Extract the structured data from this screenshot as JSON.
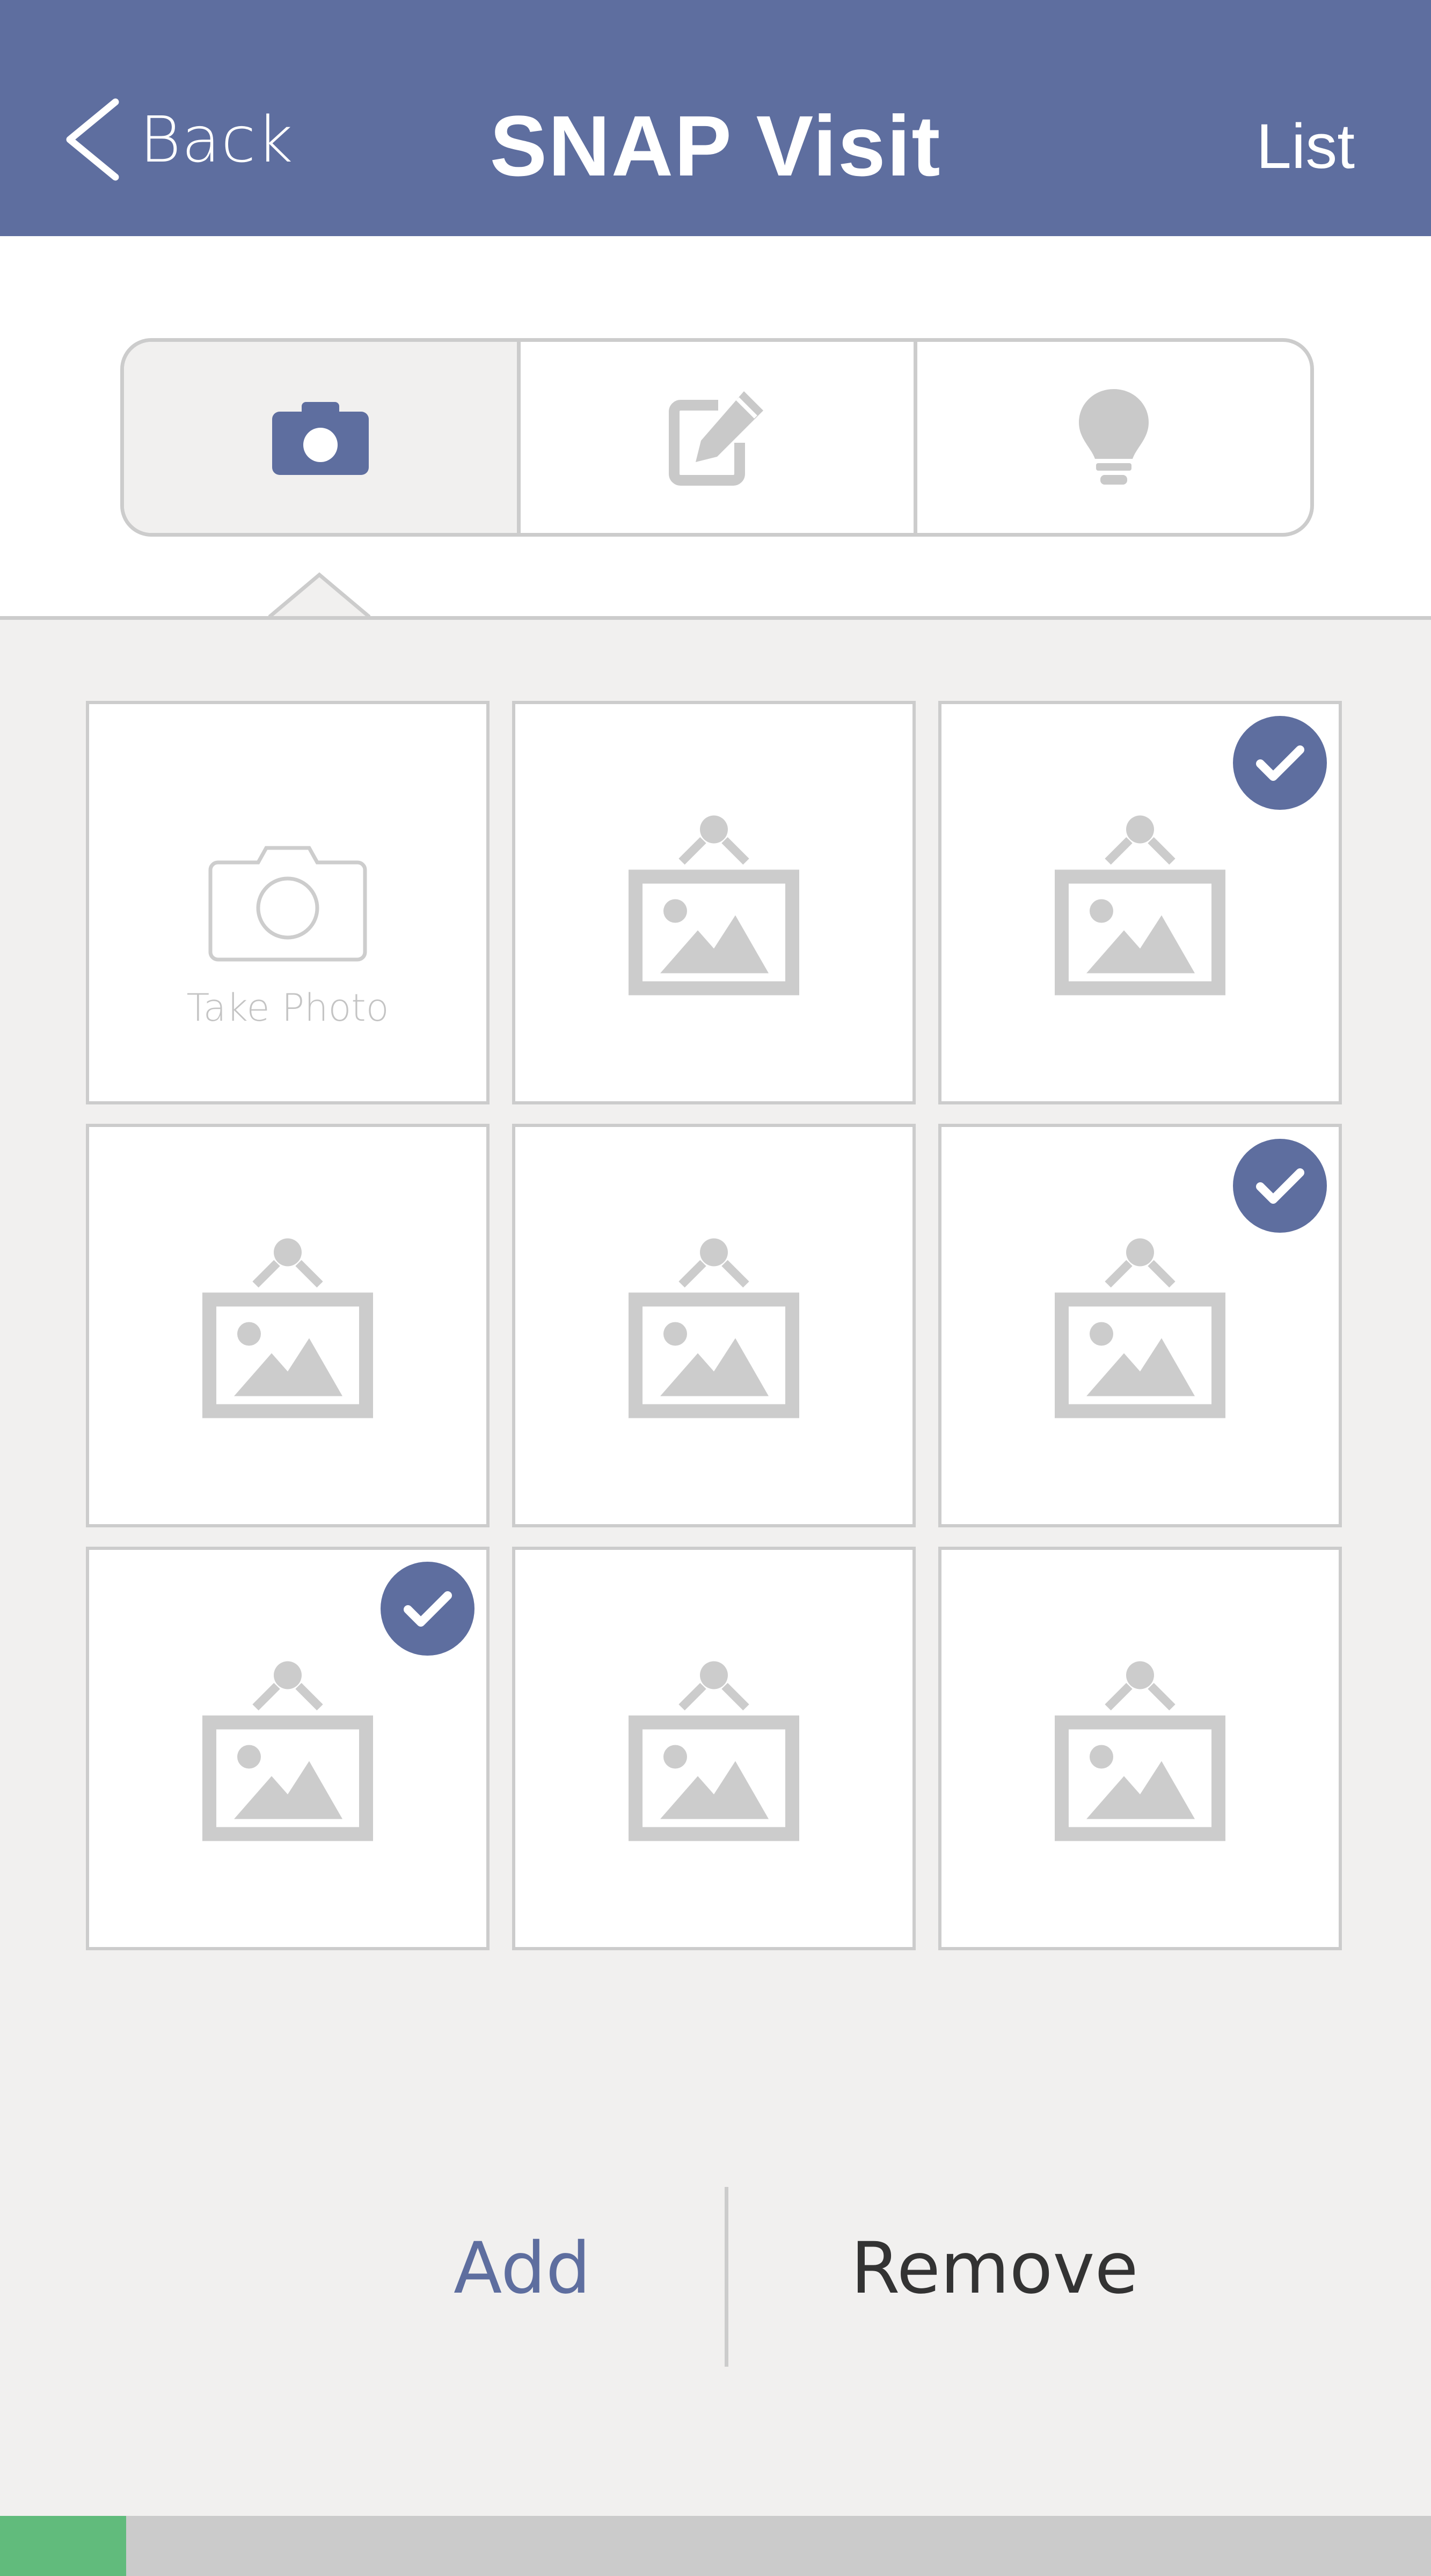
{
  "header": {
    "back_label": "Back",
    "title": "SNAP Visit",
    "list_label": "List"
  },
  "tabs": [
    {
      "icon": "camera-icon",
      "active": true
    },
    {
      "icon": "edit-icon",
      "active": false
    },
    {
      "icon": "lightbulb-icon",
      "active": false
    }
  ],
  "grid": {
    "take_photo_label": "Take Photo",
    "cells": [
      {
        "type": "take-photo",
        "checked": false
      },
      {
        "type": "photo",
        "checked": false
      },
      {
        "type": "photo",
        "checked": true
      },
      {
        "type": "photo",
        "checked": false
      },
      {
        "type": "photo",
        "checked": false
      },
      {
        "type": "photo",
        "checked": true
      },
      {
        "type": "photo",
        "checked": true
      },
      {
        "type": "photo",
        "checked": false
      },
      {
        "type": "photo",
        "checked": false
      }
    ]
  },
  "actions": {
    "add_label": "Add",
    "remove_label": "Remove"
  },
  "progress": {
    "fraction": 0.088
  },
  "colors": {
    "brand": "#5e6e9f",
    "panel_bg": "#f1f0ef",
    "border": "#cccccc",
    "progress": "#61bb7c"
  }
}
